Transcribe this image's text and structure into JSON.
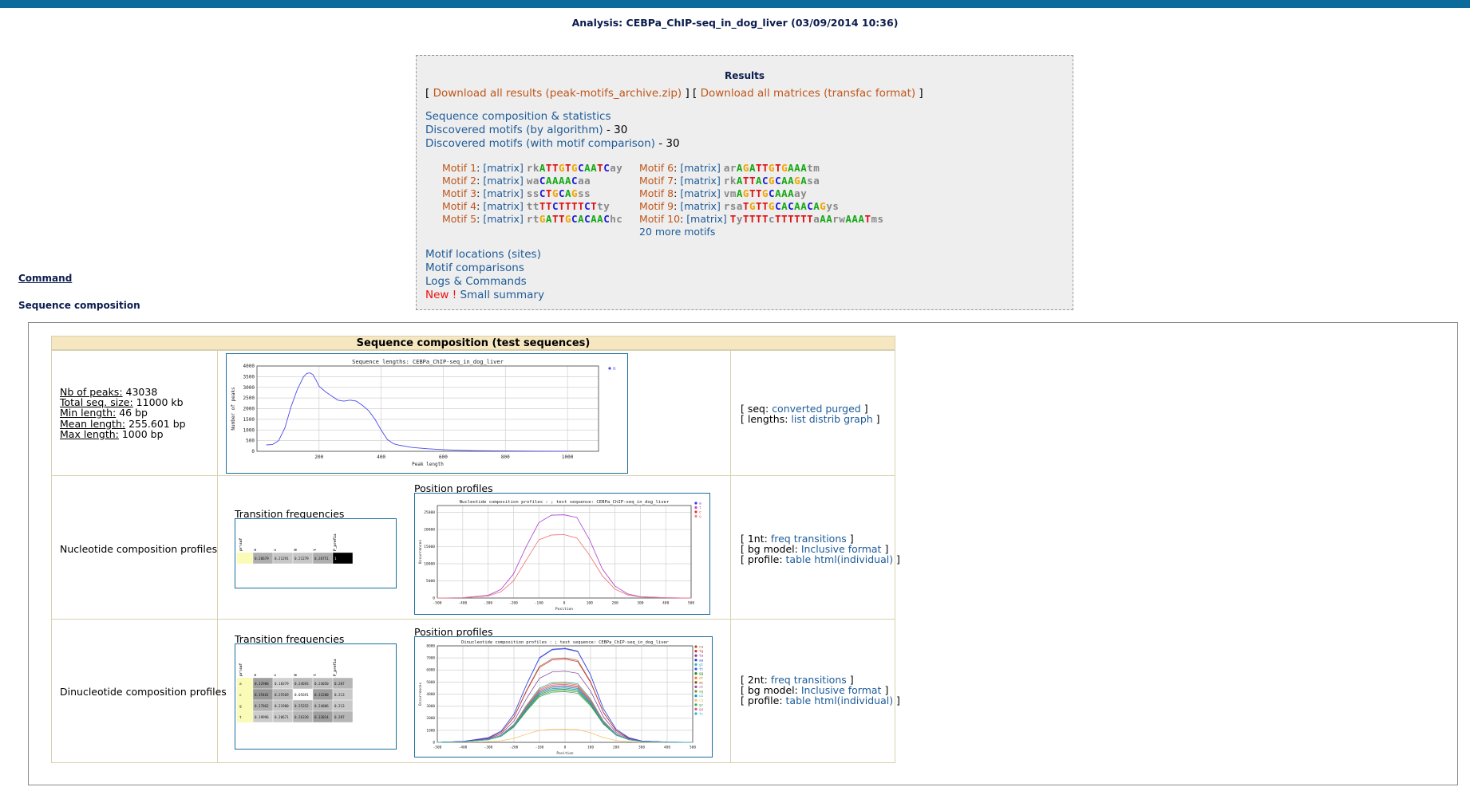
{
  "header": {
    "title": "Analysis: CEBPa_ChIP-seq_in_dog_liver (03/09/2014 10:36)"
  },
  "results": {
    "heading": "Results",
    "download_all": "Download all results (peak-motifs_archive.zip)",
    "download_matrices": "Download all matrices (transfac format)",
    "seq_comp_link": "Sequence composition & statistics",
    "disc_algo_link": "Discovered motifs (by algorithm)",
    "disc_algo_count": " - 30",
    "disc_comp_link": "Discovered motifs (with motif comparison)",
    "disc_comp_count": " - 30",
    "matrix_label": "[matrix]",
    "more_motifs": "20 more motifs",
    "motifs": [
      {
        "label": "Motif 1",
        "logo": "rkATTGTGCAATCay"
      },
      {
        "label": "Motif 2",
        "logo": "waCAAAACaa"
      },
      {
        "label": "Motif 3",
        "logo": "ssCTGCAGss"
      },
      {
        "label": "Motif 4",
        "logo": "ttTTCTTTTCTty"
      },
      {
        "label": "Motif 5",
        "logo": "rtGATTGCACAAChc"
      },
      {
        "label": "Motif 6",
        "logo": "arAGATTGTGAAAtm"
      },
      {
        "label": "Motif 7",
        "logo": "rkATTACGCAAGAsa"
      },
      {
        "label": "Motif 8",
        "logo": "vmAGTTGCAAAay"
      },
      {
        "label": "Motif 9",
        "logo": "rsaTGTTGCACAACAGys"
      },
      {
        "label": "Motif 10",
        "logo": "TyTTTTcTTTTTTaAArwAAATms"
      }
    ],
    "locations_link": "Motif locations (sites)",
    "comparisons_link": "Motif comparisons",
    "logs_link": "Logs & Commands",
    "new_label": "New !",
    "summary_link": "Small summary"
  },
  "command_link": "Command",
  "seq_comp_heading": "Sequence composition",
  "comp_table": {
    "title": "Sequence composition (test sequences)",
    "stats": [
      {
        "label": "Nb of peaks:",
        "value": " 43038"
      },
      {
        "label": "Total seq. size:",
        "value": " 11000 kb"
      },
      {
        "label": "Min length:",
        "value": " 46 bp"
      },
      {
        "label": "Mean length:",
        "value": " 255.601 bp"
      },
      {
        "label": "Max length:",
        "value": " 1000 bp"
      }
    ],
    "row1_actions": {
      "seq_prefix": "[ seq: ",
      "converted": "converted",
      "purged": "purged",
      "seq_suffix": " ]",
      "len_prefix": "[ lengths: ",
      "list": "list",
      "distrib": "distrib",
      "graph": "graph",
      "len_suffix": " ]"
    },
    "row2_label": "Nucleotide composition profiles",
    "row3_label": "Dinucleotide composition profiles",
    "transition_label": "Transition frequencies",
    "position_label": "Position profiles",
    "row2_actions": {
      "p1": "[ 1nt: ",
      "freq": "freq",
      "transitions": "transitions",
      "s1": " ]",
      "p2": "[ bg model: ",
      "inclusive": "Inclusive",
      "format": "format",
      "s2": " ]",
      "p3": "[ profile: ",
      "table": "table",
      "html": "html(individual)",
      "s3": " ]"
    },
    "row3_actions": {
      "p1": "[ 2nt: ",
      "freq": "freq",
      "transitions": "transitions",
      "s1": " ]",
      "p2": "[ bg model: ",
      "inclusive": "Inclusive",
      "format": "format",
      "s2": " ]",
      "p3": "[ profile: ",
      "table": "table",
      "html": "html(individual)",
      "s3": " ]"
    }
  },
  "transition_tables": {
    "headers": [
      "pr\\suf",
      "a",
      "c",
      "g",
      "t",
      "P_prefix"
    ],
    "nt_rows": [
      [
        "",
        "0.28679",
        "0.21291",
        "0.21279",
        "0.28751",
        "1"
      ]
    ],
    "dinuc_rows": [
      [
        "a",
        "0.32908",
        "0.18379",
        "0.24693",
        "0.24050",
        "0.287"
      ],
      [
        "c",
        "0.35461",
        "0.25569",
        "0.05691",
        "0.33280",
        "0.213"
      ],
      [
        "g",
        "0.27862",
        "0.21980",
        "0.25352",
        "0.24806",
        "0.213"
      ],
      [
        "t",
        "0.19996",
        "0.20671",
        "0.26320",
        "0.33014",
        "0.287"
      ]
    ]
  },
  "chart_data": [
    {
      "type": "line",
      "title": "Sequence lengths: CEBPa_ChIP-seq_in_dog_liver",
      "xlabel": "Peak length",
      "ylabel": "Number of peaks",
      "xlim": [
        0,
        1100
      ],
      "ylim": [
        0,
        4000
      ],
      "xticks": [
        200,
        400,
        600,
        800,
        1000
      ],
      "yticks": [
        0,
        500,
        1000,
        1500,
        2000,
        2500,
        3000,
        3500,
        4000
      ],
      "grid": true,
      "legend": "top-right",
      "series": [
        {
          "name": "n",
          "color": "#4a4aee",
          "x": [
            30,
            50,
            70,
            90,
            110,
            130,
            150,
            160,
            170,
            180,
            190,
            200,
            220,
            240,
            260,
            280,
            300,
            320,
            340,
            360,
            380,
            400,
            420,
            440,
            460,
            480,
            500,
            550,
            600,
            650,
            700,
            800,
            900,
            1000
          ],
          "y": [
            300,
            320,
            500,
            1100,
            2100,
            2900,
            3500,
            3650,
            3680,
            3600,
            3350,
            3050,
            2800,
            2600,
            2400,
            2350,
            2400,
            2350,
            2150,
            1900,
            1500,
            1000,
            550,
            350,
            280,
            230,
            180,
            120,
            80,
            50,
            30,
            15,
            8,
            3
          ]
        }
      ]
    },
    {
      "type": "line",
      "title": "Nucleotide composition profiles : ; test sequence: CEBPa_ChIP-seq_in_dog_liver",
      "xlabel": "Position",
      "ylabel": "Occurrences",
      "xlim": [
        -500,
        500
      ],
      "ylim": [
        0,
        27000
      ],
      "xticks": [
        -500,
        -400,
        -300,
        -200,
        -100,
        0,
        100,
        200,
        300,
        400,
        500
      ],
      "yticks": [
        0,
        5000,
        10000,
        15000,
        20000,
        25000
      ],
      "grid": true,
      "legend": "top-right",
      "x": [
        -500,
        -400,
        -300,
        -250,
        -200,
        -150,
        -100,
        -50,
        0,
        50,
        100,
        150,
        200,
        250,
        300,
        400,
        500
      ],
      "series": [
        {
          "name": "a",
          "color": "#3a3aee",
          "values": [
            0,
            100,
            800,
            2500,
            7000,
            15000,
            22000,
            24200,
            24300,
            23500,
            17000,
            8500,
            3500,
            1200,
            400,
            100,
            0
          ]
        },
        {
          "name": "t",
          "color": "#c94ac9",
          "values": [
            0,
            100,
            800,
            2500,
            7000,
            15000,
            22000,
            24200,
            24300,
            23500,
            17000,
            8500,
            3500,
            1200,
            400,
            100,
            0
          ]
        },
        {
          "name": "c",
          "color": "#ee3333",
          "values": [
            0,
            80,
            600,
            1800,
            5000,
            11000,
            17000,
            18400,
            18500,
            17500,
            12500,
            6500,
            2600,
            900,
            300,
            80,
            0
          ]
        },
        {
          "name": "g",
          "color": "#ee8888",
          "values": [
            0,
            80,
            600,
            1800,
            5000,
            11000,
            17000,
            18400,
            18500,
            17500,
            12500,
            6500,
            2600,
            900,
            300,
            80,
            0
          ]
        }
      ]
    },
    {
      "type": "line",
      "title": "Dinucleotide composition profiles : ; test sequence: CEBPa_ChIP-seq_in_dog_liver",
      "xlabel": "Position",
      "ylabel": "Occurrences",
      "xlim": [
        -500,
        500
      ],
      "ylim": [
        0,
        8000
      ],
      "xticks": [
        -500,
        -400,
        -300,
        -200,
        -100,
        0,
        100,
        200,
        300,
        400,
        500
      ],
      "yticks": [
        0,
        1000,
        2000,
        3000,
        4000,
        5000,
        6000,
        7000,
        8000
      ],
      "grid": true,
      "legend": "top-right",
      "x": [
        -500,
        -400,
        -300,
        -250,
        -200,
        -150,
        -100,
        -50,
        0,
        50,
        100,
        150,
        200,
        250,
        300,
        400,
        500
      ],
      "shape": [
        0,
        0.01,
        0.05,
        0.12,
        0.3,
        0.62,
        0.9,
        0.99,
        1.0,
        0.97,
        0.72,
        0.36,
        0.14,
        0.05,
        0.015,
        0.003,
        0
      ],
      "series": [
        {
          "name": "ca",
          "color": "#a0522d",
          "peak": 7000
        },
        {
          "name": "tg",
          "color": "#cc3333",
          "peak": 6900
        },
        {
          "name": "ta",
          "color": "#7a3a9a",
          "peak": 5900
        },
        {
          "name": "aa",
          "color": "#3333cc",
          "peak": 7800
        },
        {
          "name": "gt",
          "color": "#2ab3b3",
          "peak": 5000
        },
        {
          "name": "tt",
          "color": "#3355ee",
          "peak": 7750
        },
        {
          "name": "gg",
          "color": "#228822",
          "peak": 4400
        },
        {
          "name": "at",
          "color": "#ee7722",
          "peak": 4900
        },
        {
          "name": "ac",
          "color": "#884400",
          "peak": 4600
        },
        {
          "name": "ct",
          "color": "#aa4499",
          "peak": 4700
        },
        {
          "name": "ag",
          "color": "#669933",
          "peak": 4300
        },
        {
          "name": "cc",
          "color": "#0099cc",
          "peak": 4500
        },
        {
          "name": "cg",
          "color": "#f0c060",
          "peak": 1100
        },
        {
          "name": "gc",
          "color": "#33aa66",
          "peak": 4200
        },
        {
          "name": "ga",
          "color": "#dd5577",
          "peak": 4800
        },
        {
          "name": "tc",
          "color": "#22bbcc",
          "peak": 4600
        }
      ]
    }
  ]
}
